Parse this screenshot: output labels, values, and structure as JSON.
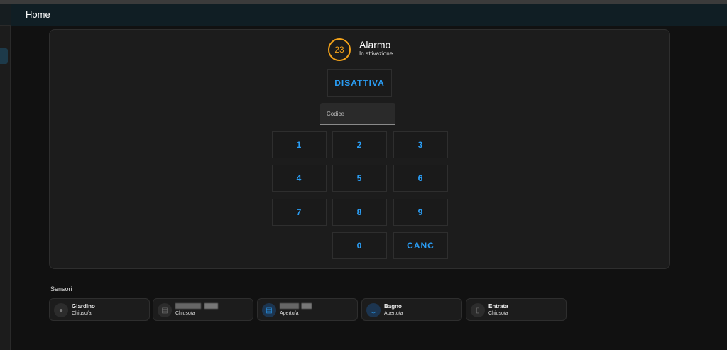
{
  "header": {
    "title": "Home"
  },
  "alarm": {
    "countdown": "23",
    "name": "Alarmo",
    "state": "In attivazione",
    "action_label": "DISATTIVA",
    "code_label": "Codice",
    "keys": [
      "1",
      "2",
      "3",
      "4",
      "5",
      "6",
      "7",
      "8",
      "9",
      "0",
      "CANC"
    ]
  },
  "colors": {
    "accent": "#2a9df4",
    "pending": "#f3a21a"
  },
  "sensors": {
    "title": "Sensori",
    "items": [
      {
        "name": "Giardino",
        "state": "Chiuso/a",
        "icon": "tree-icon",
        "active": false
      },
      {
        "name": "",
        "state": "Chiuso/a",
        "icon": "bed-icon",
        "active": false
      },
      {
        "name": "",
        "state": "Aperto/a",
        "icon": "bed-icon",
        "active": true
      },
      {
        "name": "Bagno",
        "state": "Aperto/a",
        "icon": "toilet-icon",
        "active": true
      },
      {
        "name": "Entrata",
        "state": "Chiuso/a",
        "icon": "door-icon",
        "active": false
      }
    ]
  }
}
